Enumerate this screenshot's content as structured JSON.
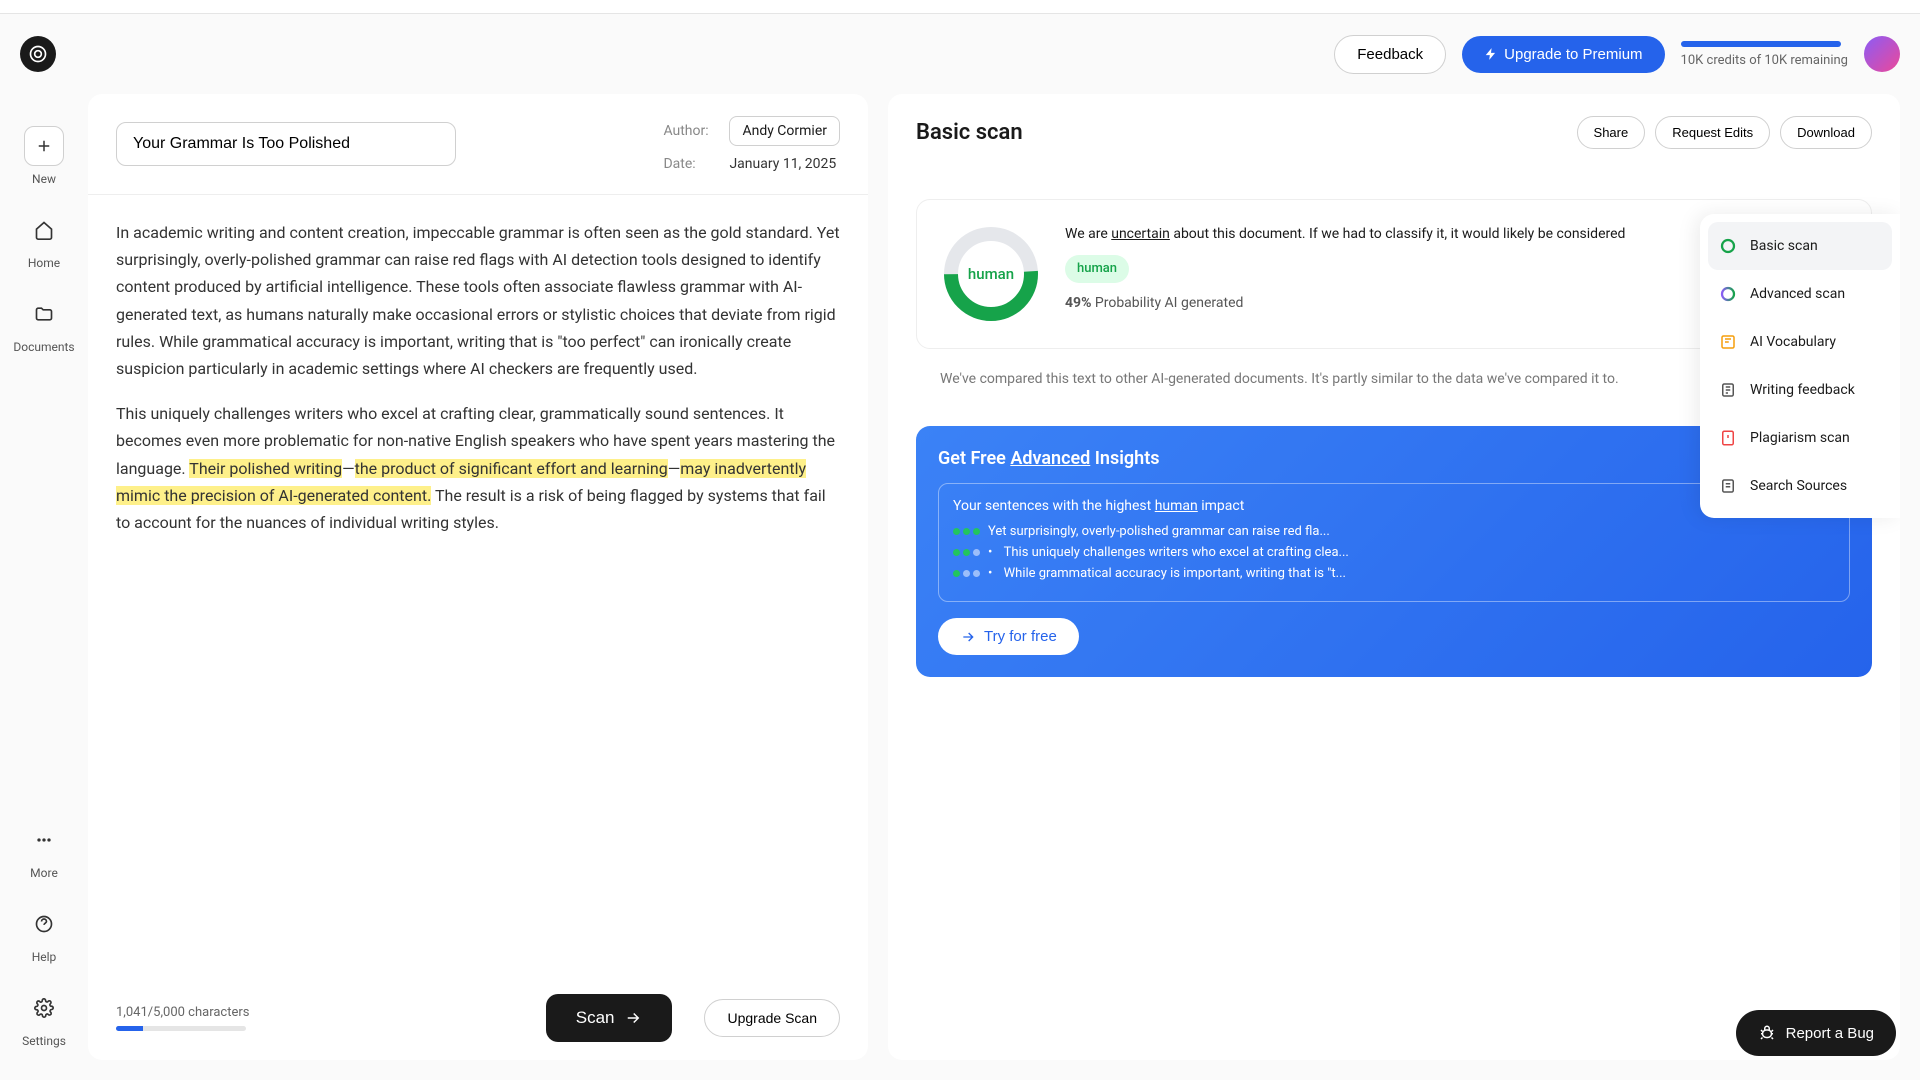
{
  "header": {
    "feedback": "Feedback",
    "upgrade": "Upgrade to Premium",
    "credits": "10K credits of 10K remaining"
  },
  "sidebar": {
    "new": "New",
    "home": "Home",
    "documents": "Documents",
    "more": "More",
    "help": "Help",
    "settings": "Settings"
  },
  "editor": {
    "title": "Your Grammar Is Too Polished",
    "author_label": "Author:",
    "author": "Andy Cormier",
    "date_label": "Date:",
    "date": "January 11, 2025",
    "para1": "In academic writing and content creation, impeccable grammar is often seen as the gold standard. Yet surprisingly, overly-polished grammar can raise red flags with AI detection tools designed to identify content produced by artificial intelligence. These tools often associate flawless grammar with AI-generated text, as humans naturally make occasional errors or stylistic choices that deviate from rigid rules. While grammatical accuracy is important, writing that is \"too perfect\" can ironically create suspicion particularly in academic settings where AI checkers are frequently used.",
    "para2_a": "This uniquely challenges writers who excel at crafting clear, grammatically sound sentences. It becomes even more problematic for non-native English speakers who have spent years mastering the language. ",
    "para2_hl1": "Their polished writing",
    "para2_b": "—",
    "para2_hl2": "the product of significant effort and learning",
    "para2_c": "—",
    "para2_hl3": "may inadvertently mimic the precision of AI-generated content.",
    "para2_d": " The result is a risk of being flagged by systems that fail to account for the nuances of individual writing styles.",
    "char_count": "1,041/5,000 characters",
    "scan_btn": "Scan",
    "upgrade_scan": "Upgrade Scan"
  },
  "results": {
    "title": "Basic scan",
    "share": "Share",
    "request_edits": "Request Edits",
    "download": "Download",
    "donut_label": "human",
    "uncertain_pre": "We are ",
    "uncertain_word": "uncertain",
    "uncertain_post": " about this document. If we had to classify it, it would likely be considered",
    "human_chip": "human",
    "prob_pct": "49%",
    "prob_text": " Probability AI generated",
    "compare": "We've compared this text to other AI-generated documents. It's partly similar to the data we've compared it to.",
    "insights_pre": "Get Free ",
    "insights_adv": "Advanced",
    "insights_post": " Insights",
    "insights_heading_pre": "Your sentences with the highest ",
    "insights_heading_u": "human",
    "insights_heading_post": " impact",
    "row1": "Yet surprisingly, overly-polished grammar can raise red fla...",
    "row2": "This uniquely challenges writers who excel at crafting clea...",
    "row3": "While grammatical accuracy is important, writing that is \"t...",
    "try_free": "Try for free"
  },
  "tools": {
    "basic": "Basic scan",
    "advanced": "Advanced scan",
    "vocab": "AI Vocabulary",
    "feedback": "Writing feedback",
    "plagiarism": "Plagiarism scan",
    "sources": "Search Sources"
  },
  "report_bug": "Report a Bug",
  "chart_data": {
    "type": "pie",
    "title": "AI generation probability",
    "values": [
      49,
      51
    ],
    "categories": [
      "AI generated probability",
      "Human probability"
    ],
    "colors": [
      "#e5e7eb",
      "#16a34a"
    ]
  }
}
